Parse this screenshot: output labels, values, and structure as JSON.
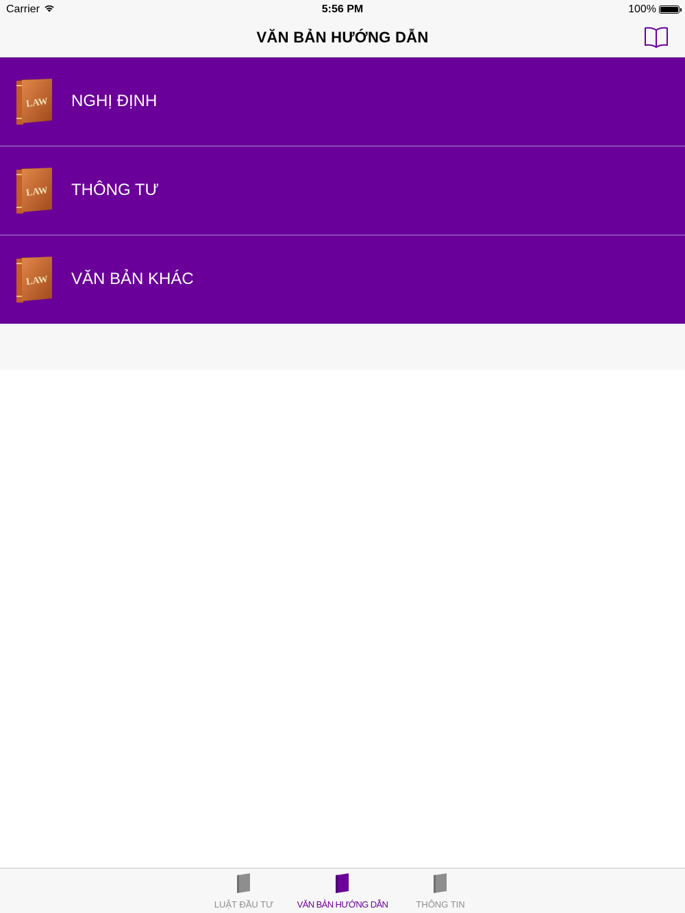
{
  "status_bar": {
    "carrier": "Carrier",
    "time": "5:56 PM",
    "battery": "100%"
  },
  "nav": {
    "title": "VĂN BẢN HƯỚNG DẪN",
    "right_icon": "open-book-icon"
  },
  "list": {
    "items": [
      {
        "label": "NGHỊ ĐỊNH",
        "icon": "law-book-icon",
        "icon_text": "LAW"
      },
      {
        "label": "THÔNG TƯ",
        "icon": "law-book-icon",
        "icon_text": "LAW"
      },
      {
        "label": "VĂN BẢN KHÁC",
        "icon": "law-book-icon",
        "icon_text": "LAW"
      }
    ]
  },
  "tabs": [
    {
      "label": "LUẬT ĐẦU TƯ",
      "icon": "book-icon",
      "active": false
    },
    {
      "label": "VĂN BẢN HƯỚNG DẪN",
      "icon": "book-icon",
      "active": true
    },
    {
      "label": "THÔNG TIN",
      "icon": "book-icon",
      "active": false
    }
  ],
  "colors": {
    "accent": "#6a0099",
    "row_background": "#6a0099",
    "bar_background": "#f7f7f7",
    "inactive_tab": "#8e8e8e"
  }
}
